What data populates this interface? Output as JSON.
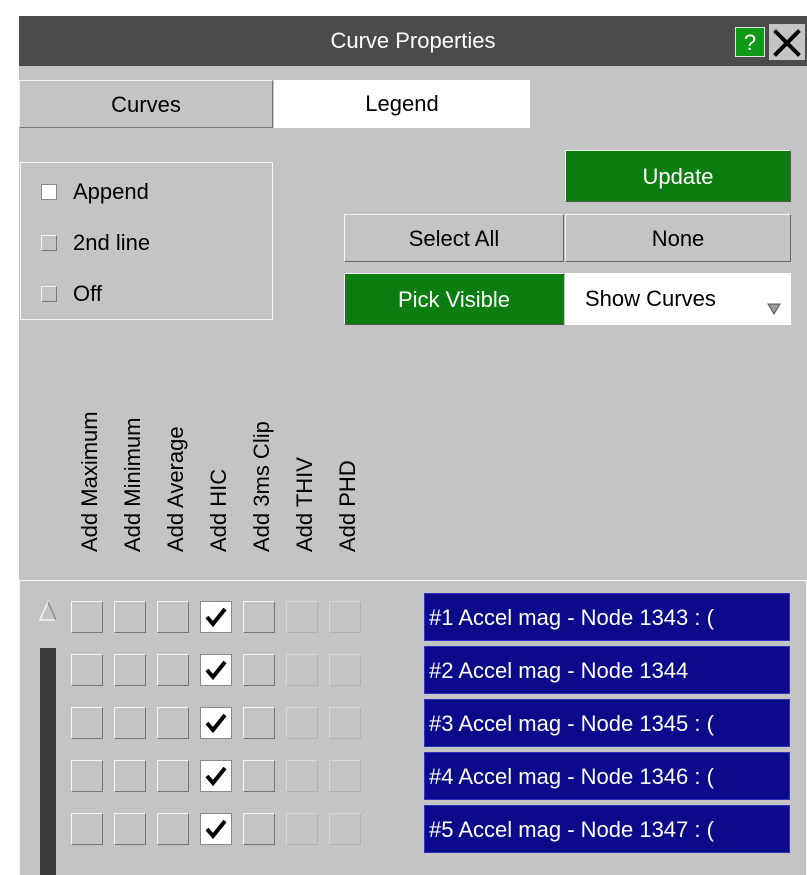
{
  "window": {
    "title": "Curve Properties",
    "help_label": "?"
  },
  "tabs": [
    {
      "label": "Curves"
    },
    {
      "label": "Legend"
    }
  ],
  "legend_mode": [
    {
      "label": "Append",
      "selected": true
    },
    {
      "label": "2nd line",
      "selected": false
    },
    {
      "label": "Off",
      "selected": false
    }
  ],
  "buttons": {
    "update": "Update",
    "select_all": "Select All",
    "none": "None",
    "pick_visible": "Pick Visible",
    "show_curves": "Show Curves"
  },
  "columns": [
    "Add Maximum",
    "Add Minimum",
    "Add Average",
    "Add HIC",
    "Add 3ms Clip",
    "Add THIV",
    "Add PHD"
  ],
  "curves": [
    {
      "label": "#1 Accel mag - Node 1343 : (",
      "checks": [
        false,
        false,
        false,
        true,
        false,
        false,
        false
      ]
    },
    {
      "label": "#2 Accel mag - Node 1344",
      "checks": [
        false,
        false,
        false,
        true,
        false,
        false,
        false
      ]
    },
    {
      "label": "#3 Accel mag - Node 1345 : (",
      "checks": [
        false,
        false,
        false,
        true,
        false,
        false,
        false
      ]
    },
    {
      "label": "#4 Accel mag - Node 1346 : (",
      "checks": [
        false,
        false,
        false,
        true,
        false,
        false,
        false
      ]
    },
    {
      "label": "#5 Accel mag - Node 1347 : (",
      "checks": [
        false,
        false,
        false,
        true,
        false,
        false,
        false
      ]
    }
  ],
  "colors": {
    "panel": "#c4c4c4",
    "titlebar": "#4b4b4b",
    "action_green": "#0c7d10",
    "curve_label_bg": "#0a0a8a"
  }
}
